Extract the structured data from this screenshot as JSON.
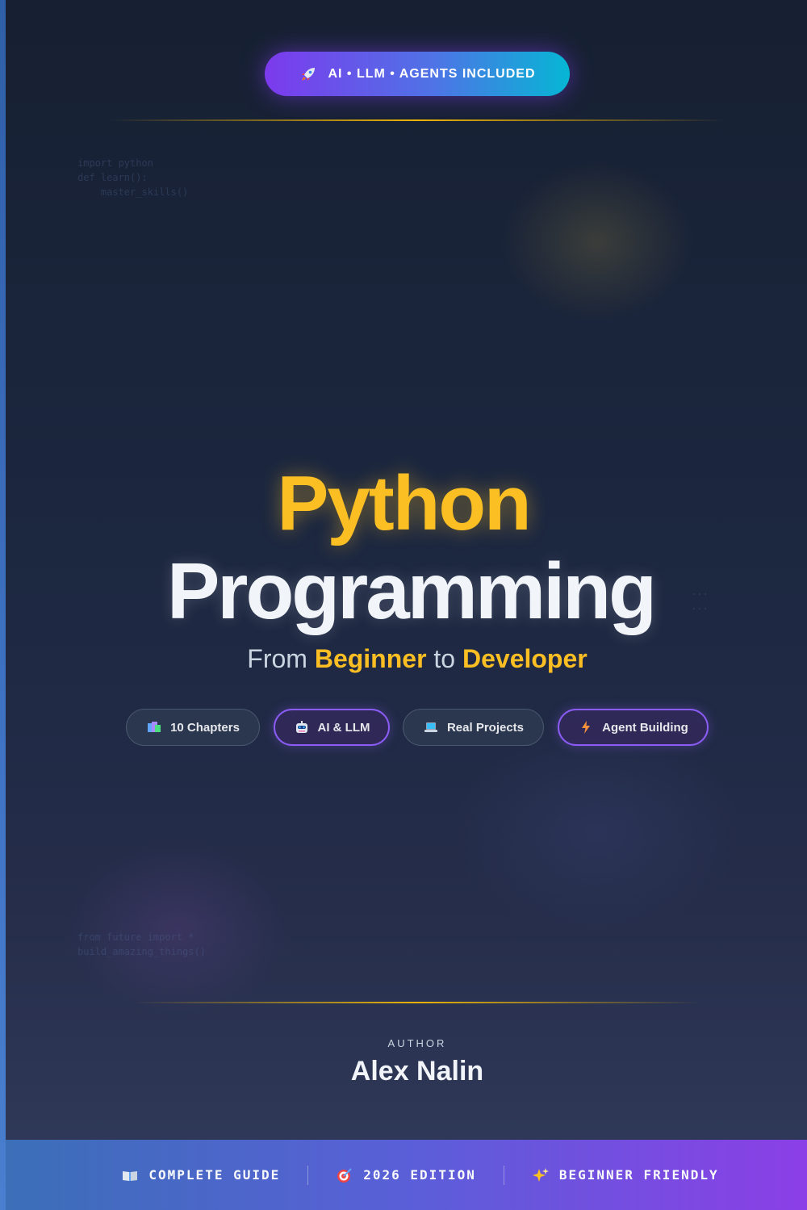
{
  "badge": {
    "icon": "rocket-icon",
    "text": "AI • LLM • AGENTS INCLUDED"
  },
  "code_snippets": {
    "top_left": "import python\ndef learn():\n    master_skills()",
    "mid_right": "...\n...",
    "bottom_left": "from future import *\nbuild_amazing_things()"
  },
  "title": {
    "line1": "Python",
    "line2": "Programming"
  },
  "subtitle": {
    "part1": "From ",
    "highlight1": "Beginner",
    "part2": " to ",
    "highlight2": "Developer"
  },
  "features": [
    {
      "icon": "books-icon",
      "label": "10 Chapters"
    },
    {
      "icon": "robot-icon",
      "label": "AI & LLM"
    },
    {
      "icon": "laptop-icon",
      "label": "Real Projects"
    },
    {
      "icon": "lightning-icon",
      "label": "Agent Building"
    }
  ],
  "author": {
    "label": "AUTHOR",
    "name": "Alex Nalin"
  },
  "footer": [
    {
      "icon": "book-icon",
      "label": "COMPLETE GUIDE"
    },
    {
      "icon": "target-icon",
      "label": "2026 EDITION"
    },
    {
      "icon": "sparkles-icon",
      "label": "BEGINNER FRIENDLY"
    }
  ],
  "colors": {
    "gold": "#fbbf24",
    "purple": "#8b5cf6",
    "cyan": "#06b6d4",
    "background": "#1c2740"
  }
}
